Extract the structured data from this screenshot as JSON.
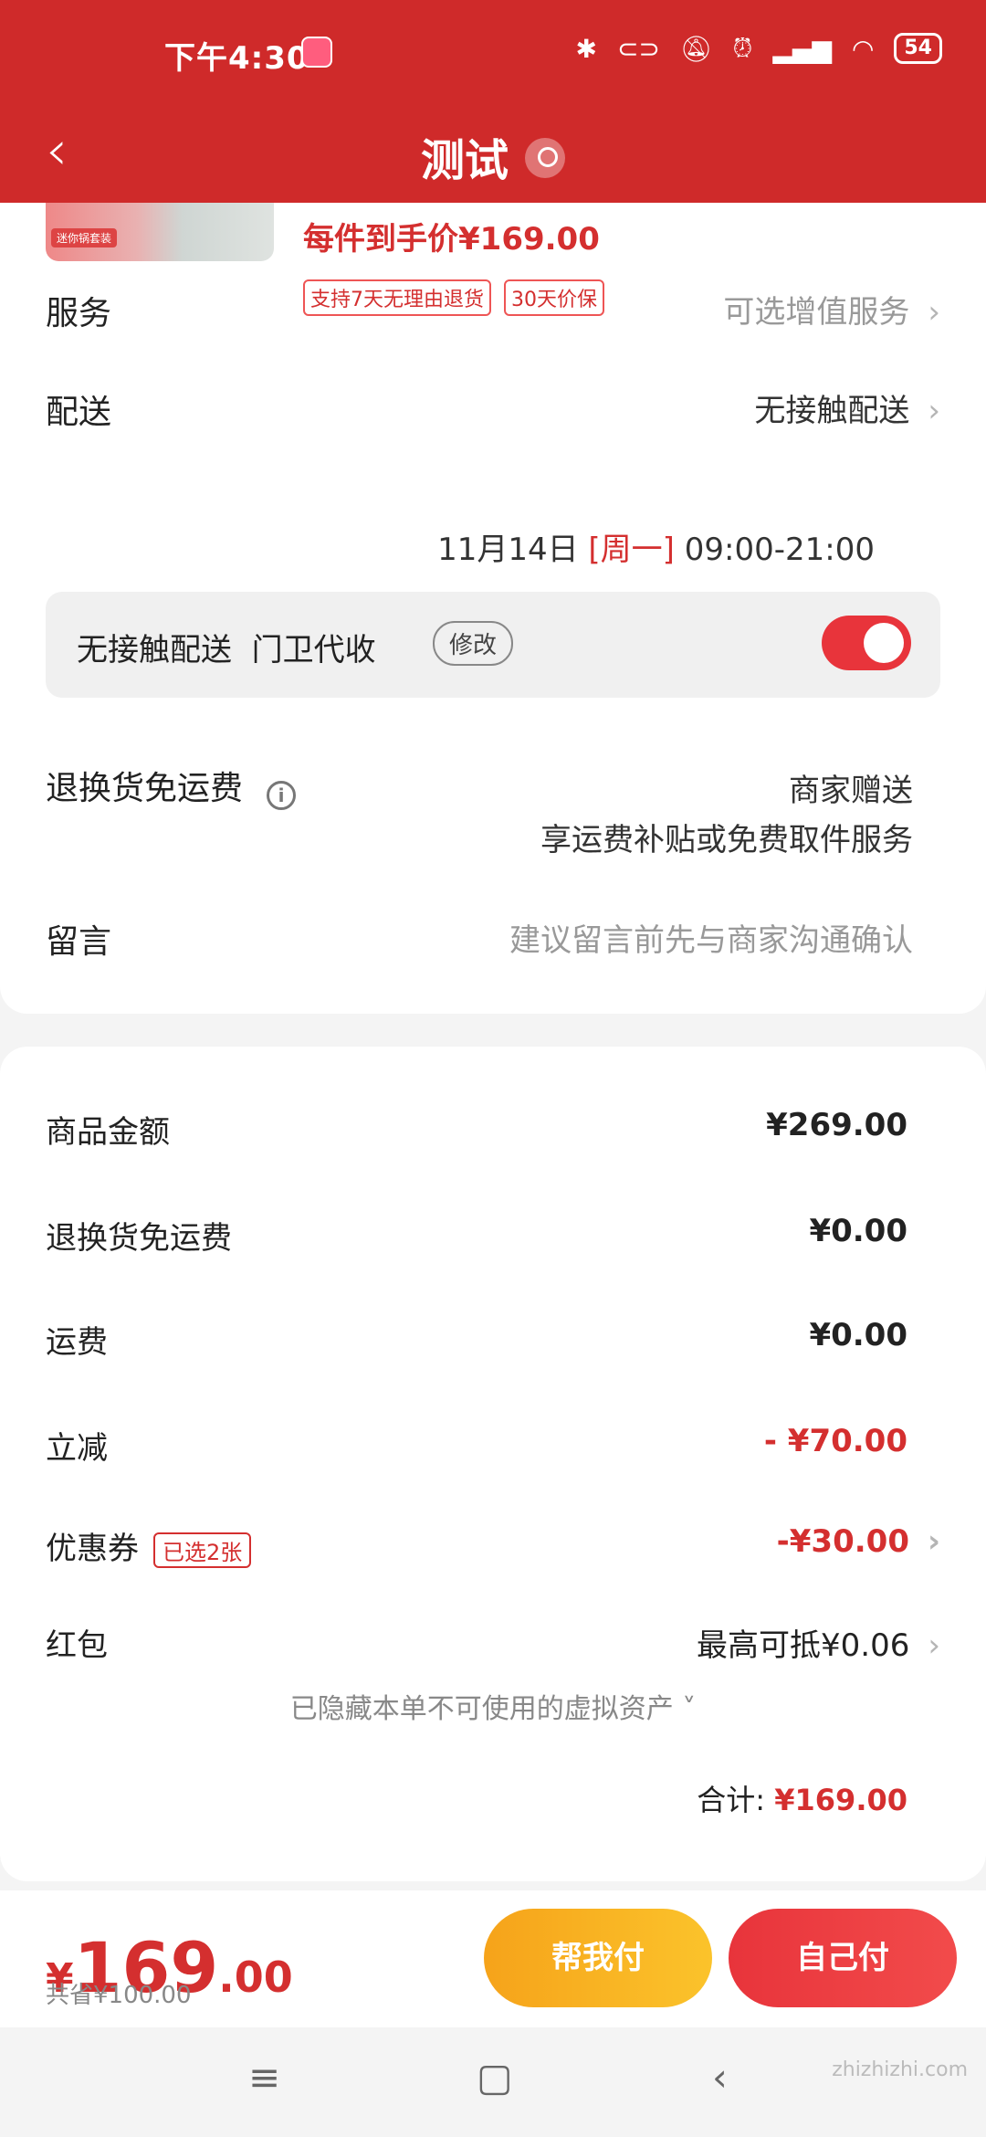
{
  "status_bar": {
    "time": "下午4:30",
    "battery": "54"
  },
  "header": {
    "title": "测试"
  },
  "product": {
    "each_price_text": "每件到手价¥169.00",
    "mini_badge": "迷你锅套装",
    "tags": [
      "支持7天无理由退货",
      "30天价保"
    ]
  },
  "service": {
    "label": "服务",
    "value": "可选增值服务"
  },
  "delivery": {
    "label": "配送",
    "value": "无接触配送",
    "date": "11月14日",
    "weekday": "[周一]",
    "time_range": "09:00-21:00",
    "box_text": "无接触配送  门卫代收",
    "modify": "修改"
  },
  "return_shipping": {
    "label": "退换货免运费",
    "value_line1": "商家赠送",
    "value_line2": "享运费补贴或免费取件服务"
  },
  "message": {
    "label": "留言",
    "placeholder": "建议留言前先与商家沟通确认"
  },
  "summary": {
    "goods_label": "商品金额",
    "goods_value": "¥269.00",
    "return_label": "退换货免运费",
    "return_value": "¥0.00",
    "shipping_label": "运费",
    "shipping_value": "¥0.00",
    "discount_label": "立减",
    "discount_value": "- ¥70.00",
    "coupon_label": "优惠券",
    "coupon_tag": "已选2张",
    "coupon_value": "-¥30.00",
    "redpacket_label": "红包",
    "redpacket_value": "最高可抵¥0.06",
    "hidden_assets": "已隐藏本单不可使用的虚拟资产 ˅",
    "total_label": "合计:",
    "total_value": "¥169.00"
  },
  "paybar": {
    "symbol": "¥",
    "integer": "169",
    "decimal": ".00",
    "saved": "共省¥100.00",
    "help_pay": "帮我付",
    "self_pay": "自己付"
  },
  "watermark": "zhizhizhi.com"
}
